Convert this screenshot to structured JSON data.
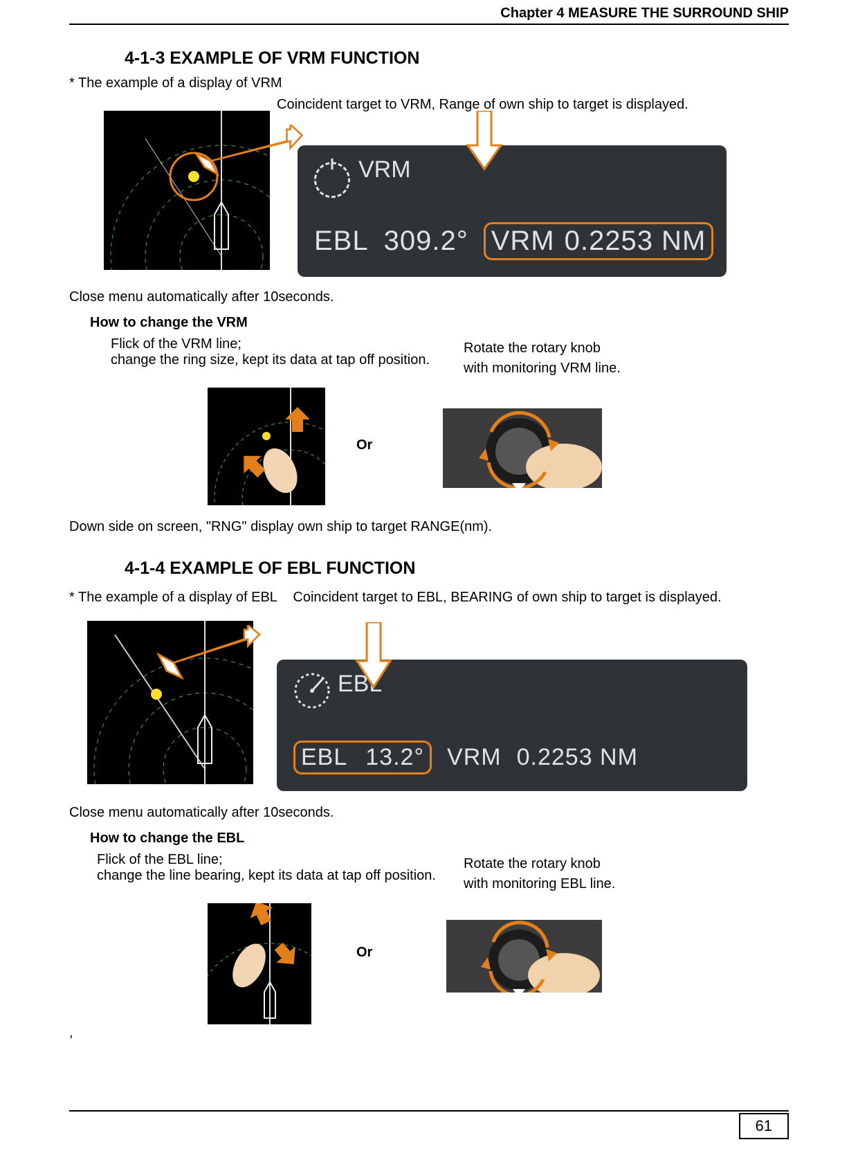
{
  "header": {
    "chapter": "Chapter 4    MEASURE THE SURROUND SHIP"
  },
  "page_number": "61",
  "section_vrm": {
    "title": "4-1-3 EXAMPLE OF VRM FUNCTION",
    "intro": "* The example of a display of VRM",
    "annotation": "Coincident target to VRM, Range of own ship to target is displayed.",
    "display": {
      "box_title": "VRM",
      "ebl_label": "EBL",
      "ebl_value": "309.2°",
      "vrm_label": "VRM",
      "vrm_value": "0.2253 NM"
    },
    "close_note": "Close menu automatically after 10seconds.",
    "howto_title": "How to change the VRM",
    "method_flick_line1": "Flick of the VRM line;",
    "method_flick_line2": "change the ring size, kept its data at tap off position.",
    "or": "Or",
    "method_rotate_line1": "Rotate the rotary knob",
    "method_rotate_line2": "with monitoring VRM line.",
    "rng_note": "Down side on screen, \"RNG\" display own ship to target RANGE(nm)."
  },
  "section_ebl": {
    "title": "4-1-4 EXAMPLE OF EBL FUNCTION",
    "intro": "* The example of a display of EBL",
    "annotation": "Coincident target to EBL, BEARING of own ship to target is displayed.",
    "display": {
      "box_title": "EBL",
      "ebl_label": "EBL",
      "ebl_value": "13.2°",
      "vrm_label": "VRM",
      "vrm_value": "0.2253 NM"
    },
    "close_note": "Close menu automatically after 10seconds.",
    "howto_title": "How to change the EBL",
    "method_flick_line1": "Flick of the EBL line;",
    "method_flick_line2": "change the line bearing, kept its data at tap off position.",
    "or": "Or",
    "method_rotate_line1": "Rotate the rotary knob",
    "method_rotate_line2": "with monitoring EBL line.",
    "trailing_comma": ","
  }
}
